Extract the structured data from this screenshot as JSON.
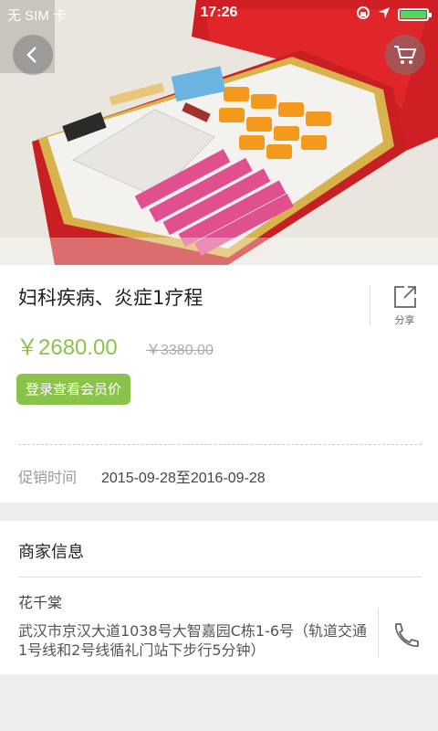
{
  "status_bar": {
    "carrier": "无 SIM 卡",
    "time": "17:26"
  },
  "product": {
    "title": "妇科疾病、炎症1疗程",
    "price": "￥2680.00",
    "original_price": "￥3380.00",
    "member_button": "登录查看会员价",
    "share_label": "分享",
    "promo_label": "促销时间",
    "promo_date": "2015-09-28至2016-09-28"
  },
  "merchant": {
    "heading": "商家信息",
    "name": "花千棠",
    "address": "武汉市京汉大道1038号大智嘉园C栋1-6号（轨道交通1号线和2号线循礼门站下步行5分钟）"
  },
  "colors": {
    "accent": "#8bc34a",
    "battery": "#4cd964"
  },
  "icons": [
    "back-icon",
    "cart-icon",
    "share-icon",
    "phone-icon"
  ]
}
